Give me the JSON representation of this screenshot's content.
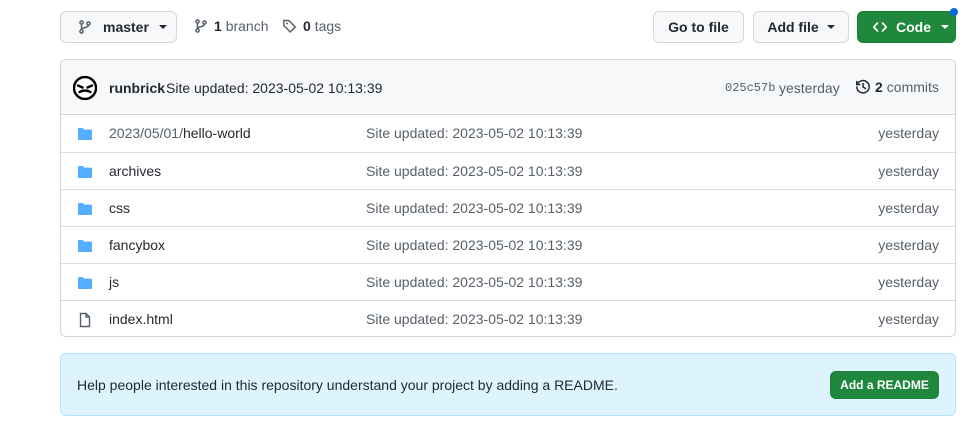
{
  "toolbar": {
    "branch_select_label": "master",
    "branch_count": "1",
    "branch_label": "branch",
    "tag_count": "0",
    "tag_label": "tags",
    "go_to_file_label": "Go to file",
    "add_file_label": "Add file",
    "code_label": "Code"
  },
  "latest_commit": {
    "author": "runbrick",
    "message": "Site updated: 2023-05-02 10:13:39",
    "sha": "025c57b",
    "time": "yesterday",
    "commit_count": "2",
    "commit_label": "commits"
  },
  "files": [
    {
      "type": "folder",
      "name_prefix": "2023/05/01/",
      "name": "hello-world",
      "message": "Site updated: 2023-05-02 10:13:39",
      "time": "yesterday"
    },
    {
      "type": "folder",
      "name_prefix": "",
      "name": "archives",
      "message": "Site updated: 2023-05-02 10:13:39",
      "time": "yesterday"
    },
    {
      "type": "folder",
      "name_prefix": "",
      "name": "css",
      "message": "Site updated: 2023-05-02 10:13:39",
      "time": "yesterday"
    },
    {
      "type": "folder",
      "name_prefix": "",
      "name": "fancybox",
      "message": "Site updated: 2023-05-02 10:13:39",
      "time": "yesterday"
    },
    {
      "type": "folder",
      "name_prefix": "",
      "name": "js",
      "message": "Site updated: 2023-05-02 10:13:39",
      "time": "yesterday"
    },
    {
      "type": "file",
      "name_prefix": "",
      "name": "index.html",
      "message": "Site updated: 2023-05-02 10:13:39",
      "time": "yesterday"
    }
  ],
  "readme_banner": {
    "text": "Help people interested in this repository understand your project by adding a README.",
    "button_label": "Add a README"
  },
  "colors": {
    "primary_green": "#1f883d",
    "folder_blue": "#54aeff",
    "notification_dot": "#0969da"
  }
}
